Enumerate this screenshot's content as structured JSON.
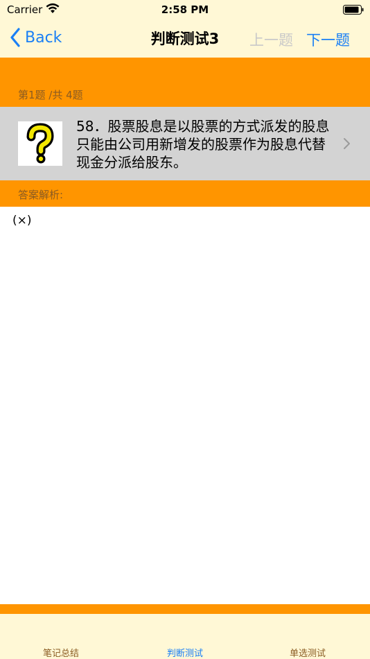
{
  "status": {
    "carrier": "Carrier",
    "time": "2:58 PM"
  },
  "nav": {
    "back_label": "Back",
    "title": "判断测试3",
    "prev_label": "上一题",
    "next_label": "下一题"
  },
  "question": {
    "progress": "第1题 /共 4题",
    "text": "58．股票股息是以股票的方式派发的股息只能由公司用新增发的股票作为股息代替现金分派给股东。"
  },
  "answer": {
    "header": "答案解析:",
    "text": "(×)"
  },
  "tabs": [
    {
      "label": "笔记总结"
    },
    {
      "label": "判断测试"
    },
    {
      "label": "单选测试"
    }
  ],
  "colors": {
    "accent": "#1a7ff5",
    "orange": "#ff9500",
    "cream": "#fff8d6"
  }
}
